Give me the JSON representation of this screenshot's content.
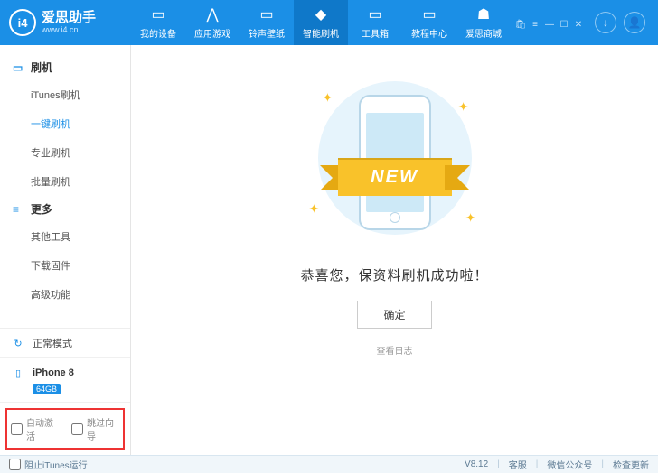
{
  "brand": {
    "name": "爱思助手",
    "url": "www.i4.cn",
    "logo_text": "i4"
  },
  "nav": {
    "items": [
      {
        "label": "我的设备"
      },
      {
        "label": "应用游戏"
      },
      {
        "label": "铃声壁纸"
      },
      {
        "label": "智能刷机"
      },
      {
        "label": "工具箱"
      },
      {
        "label": "教程中心"
      },
      {
        "label": "爱思商城"
      }
    ],
    "active_index": 3
  },
  "sidebar": {
    "sections": [
      {
        "title": "刷机",
        "items": [
          "iTunes刷机",
          "一键刷机",
          "专业刷机",
          "批量刷机"
        ],
        "active_index": 1
      },
      {
        "title": "更多",
        "items": [
          "其他工具",
          "下载固件",
          "高级功能"
        ],
        "active_index": -1
      }
    ],
    "mode": "正常模式",
    "device": {
      "name": "iPhone 8",
      "capacity": "64GB"
    }
  },
  "options": {
    "auto_activate": "自动激活",
    "skip_guide": "跳过向导"
  },
  "main": {
    "ribbon": "NEW",
    "message": "恭喜您，保资料刷机成功啦！",
    "confirm": "确定",
    "view_log": "查看日志"
  },
  "footer": {
    "block_itunes": "阻止iTunes运行",
    "version": "V8.12",
    "support": "客服",
    "wechat": "微信公众号",
    "update": "检查更新"
  }
}
